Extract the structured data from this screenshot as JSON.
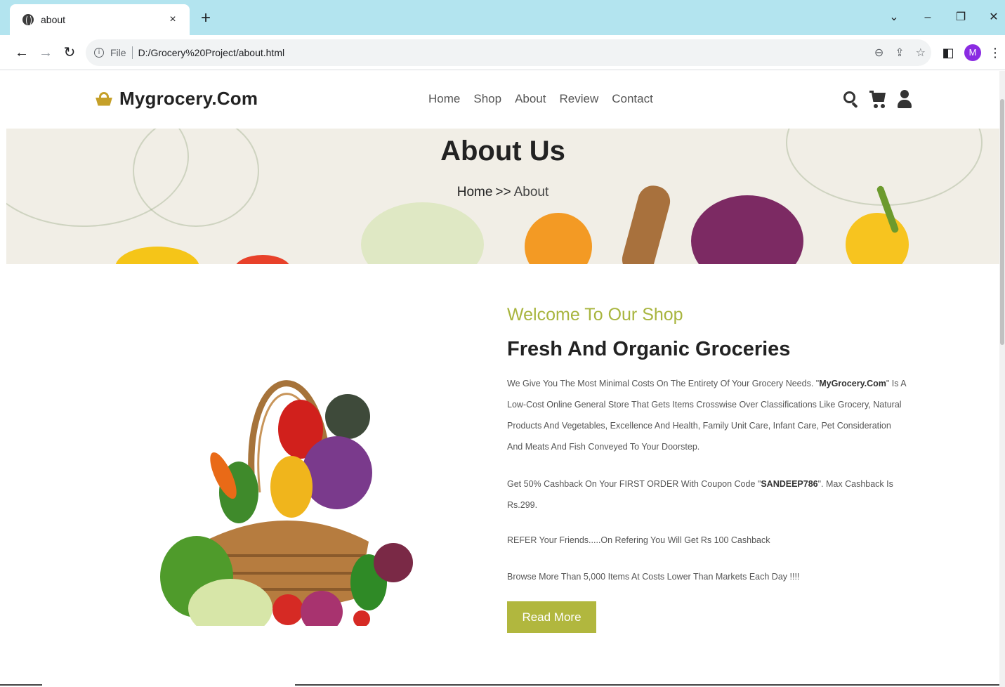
{
  "browser": {
    "tab_title": "about",
    "new_tab": "+",
    "close": "×",
    "scheme": "File",
    "url": "D:/Grocery%20Project/about.html",
    "profile_initial": "M"
  },
  "site": {
    "logo_text": "Mygrocery.Com",
    "nav": [
      "Home",
      "Shop",
      "About",
      "Review",
      "Contact"
    ]
  },
  "hero": {
    "title": "About Us",
    "crumb_home": "Home",
    "crumb_sep": ">>",
    "crumb_current": "About"
  },
  "about": {
    "welcome": "Welcome To Our Shop",
    "headline": "Fresh And Organic Groceries",
    "p1_a": "We Give You The Most Minimal Costs On The Entirety Of Your Grocery Needs. \"",
    "p1_brand": "MyGrocery.Com",
    "p1_b": "\" Is A Low-Cost Online General Store That Gets Items Crosswise Over Classifications Like Grocery, Natural Products And Vegetables, Excellence And Health, Family Unit Care, Infant Care, Pet Consideration And Meats And Fish Conveyed To Your Doorstep.",
    "p2_a": "Get 50% Cashback On Your FIRST ORDER With Coupon Code \"",
    "p2_code": "SANDEEP786",
    "p2_b": "\". Max Cashback Is Rs.299.",
    "p3": "REFER Your Friends.....On Refering You Will Get Rs 100 Cashback",
    "p4": "Browse More Than 5,000 Items At Costs Lower Than Markets Each Day !!!!",
    "button": "Read More"
  },
  "colors": {
    "accent": "#a8b53e",
    "button": "#b1b73e",
    "logo_icon": "#c5a029",
    "tabbar": "#b3e4ef"
  }
}
